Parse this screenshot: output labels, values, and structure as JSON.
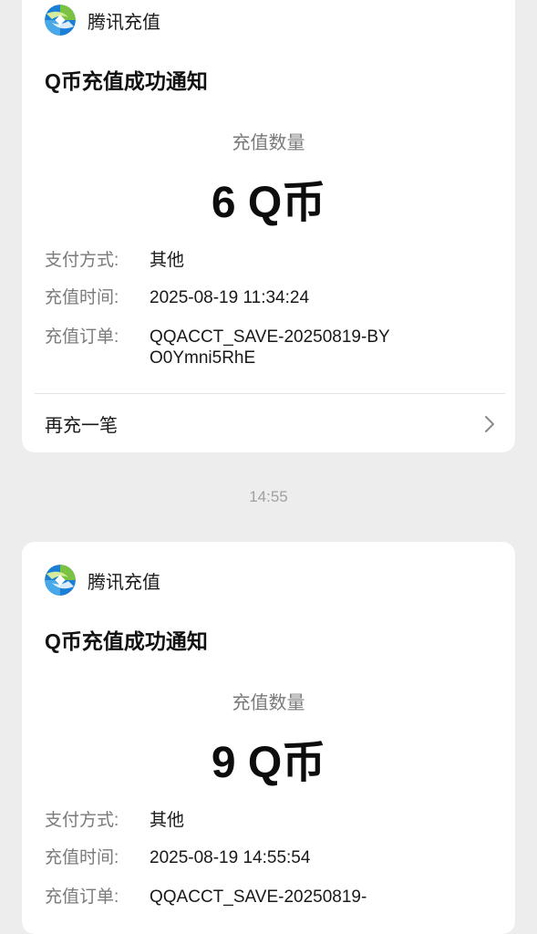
{
  "messages": [
    {
      "sender": "腾讯充值",
      "title": "Q币充值成功通知",
      "amount_label": "充值数量",
      "amount": "6 Q币",
      "fields": [
        {
          "key": "支付方式:",
          "value": "其他"
        },
        {
          "key": "充值时间:",
          "value": "2025-08-19 11:34:24"
        },
        {
          "key": "充值订单:",
          "value": "QQACCT_SAVE-20250819-BYO0Ymni5RhE"
        }
      ],
      "action": "再充一笔"
    },
    {
      "sender": "腾讯充值",
      "title": "Q币充值成功通知",
      "amount_label": "充值数量",
      "amount": "9 Q币",
      "fields": [
        {
          "key": "支付方式:",
          "value": "其他"
        },
        {
          "key": "充值时间:",
          "value": "2025-08-19 14:55:54"
        },
        {
          "key": "充值订单:",
          "value": "QQACCT_SAVE-20250819-"
        }
      ]
    }
  ],
  "timestamp": "14:55",
  "icons": {
    "logo": "tencent-recharge-logo-icon",
    "chevron": "chevron-right-icon"
  },
  "colors": {
    "background": "#ededed",
    "card": "#ffffff",
    "label_gray": "#7a7a7a",
    "text": "#191919",
    "logo_blue": "#1c7fd6",
    "logo_green": "#7cc242"
  }
}
